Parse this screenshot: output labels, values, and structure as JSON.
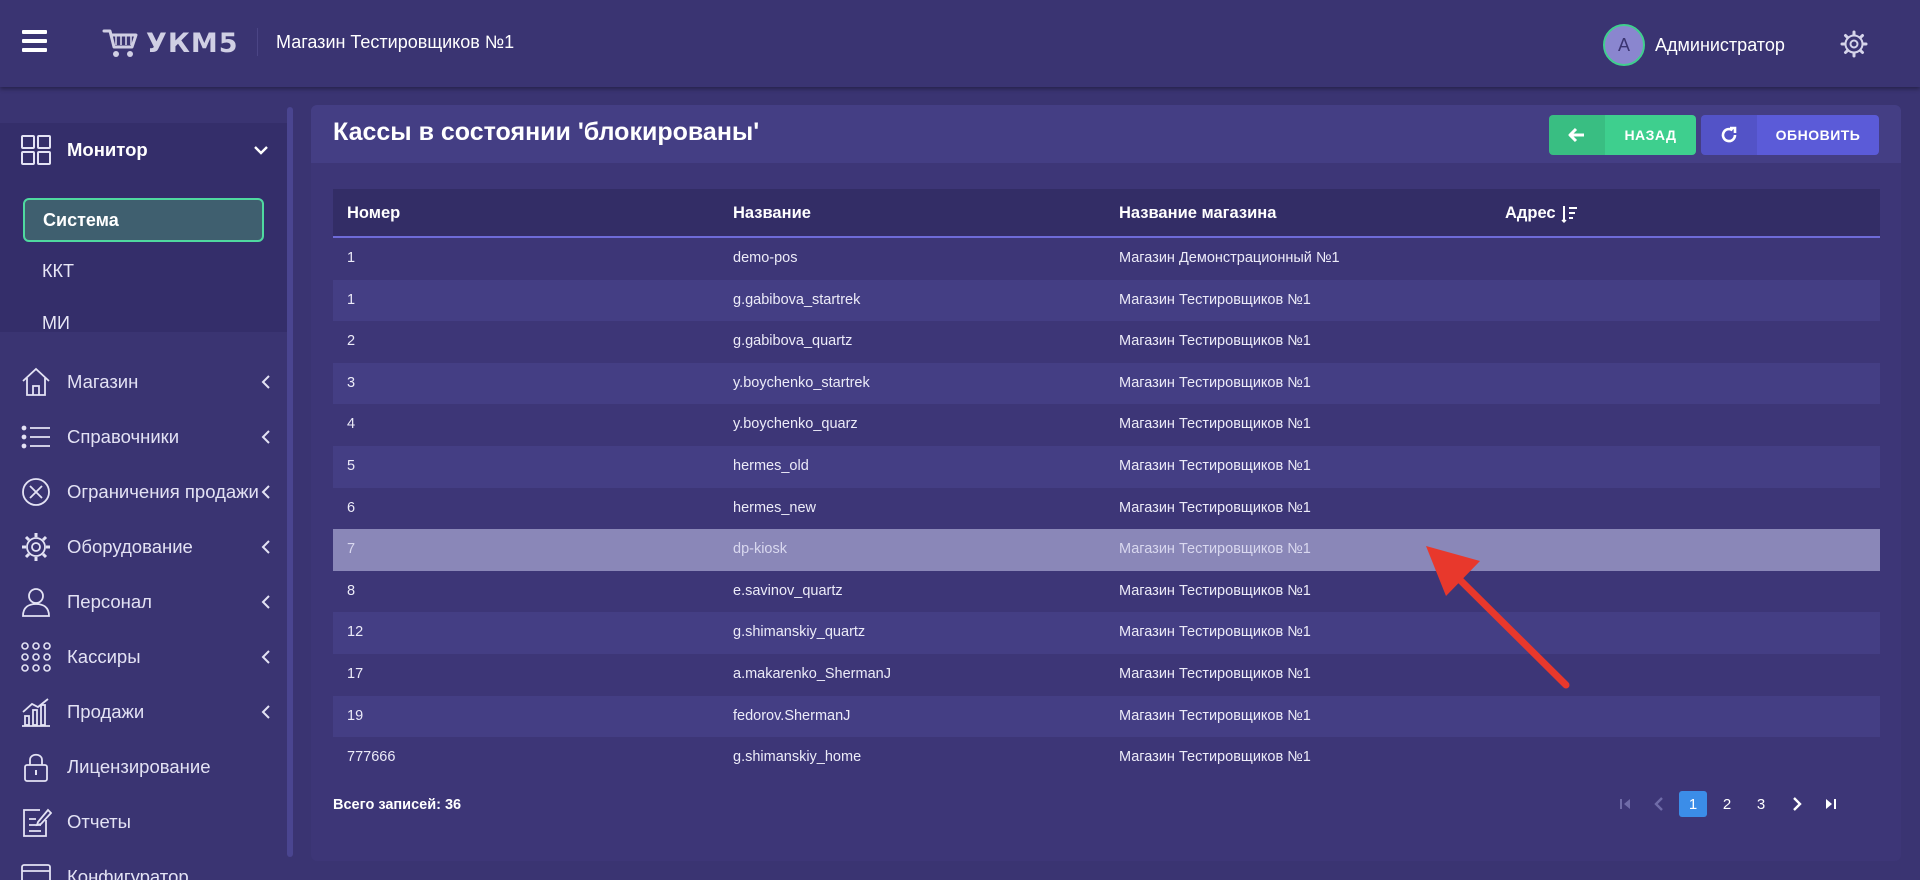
{
  "header": {
    "logo_text": "УКМ5",
    "store_name": "Магазин Тестировщиков №1",
    "avatar_letter": "А",
    "username": "Администратор"
  },
  "sidebar": {
    "monitor_label": "Монитор",
    "submenu": [
      {
        "label": "Система",
        "active": true
      },
      {
        "label": "ККТ",
        "active": false
      },
      {
        "label": "МИ",
        "active": false
      }
    ],
    "items": [
      {
        "label": "Магазин",
        "icon": "home-icon",
        "has_submenu": true
      },
      {
        "label": "Справочники",
        "icon": "list-icon",
        "has_submenu": true
      },
      {
        "label": "Ограничения продажи",
        "icon": "restriction-icon",
        "has_submenu": true
      },
      {
        "label": "Оборудование",
        "icon": "equipment-gear-icon",
        "has_submenu": true
      },
      {
        "label": "Персонал",
        "icon": "person-icon",
        "has_submenu": true
      },
      {
        "label": "Кассиры",
        "icon": "cashiers-grid-icon",
        "has_submenu": true
      },
      {
        "label": "Продажи",
        "icon": "sales-chart-icon",
        "has_submenu": true
      },
      {
        "label": "Лицензирование",
        "icon": "lock-icon",
        "has_submenu": false
      },
      {
        "label": "Отчеты",
        "icon": "report-icon",
        "has_submenu": false
      },
      {
        "label": "Конфигуратор",
        "icon": "configurator-icon",
        "has_submenu": false
      }
    ]
  },
  "panel": {
    "title": "Кассы в состоянии 'блокированы'",
    "back_label": "НАЗАД",
    "refresh_label": "ОБНОВИТЬ"
  },
  "table": {
    "columns": [
      "Номер",
      "Название",
      "Название магазина",
      "Адрес"
    ],
    "rows": [
      {
        "num": "1",
        "name": "demo-pos",
        "store": "Магазин Демонстрационный №1",
        "addr": ""
      },
      {
        "num": "1",
        "name": "g.gabibova_startrek",
        "store": "Магазин Тестировщиков №1",
        "addr": ""
      },
      {
        "num": "2",
        "name": "g.gabibova_quartz",
        "store": "Магазин Тестировщиков №1",
        "addr": ""
      },
      {
        "num": "3",
        "name": "y.boychenko_startrek",
        "store": "Магазин Тестировщиков №1",
        "addr": ""
      },
      {
        "num": "4",
        "name": "y.boychenko_quarz",
        "store": "Магазин Тестировщиков №1",
        "addr": ""
      },
      {
        "num": "5",
        "name": "hermes_old",
        "store": "Магазин Тестировщиков №1",
        "addr": ""
      },
      {
        "num": "6",
        "name": "hermes_new",
        "store": "Магазин Тестировщиков №1",
        "addr": ""
      },
      {
        "num": "7",
        "name": "dp-kiosk",
        "store": "Магазин Тестировщиков №1",
        "addr": "",
        "selected": true
      },
      {
        "num": "8",
        "name": "e.savinov_quartz",
        "store": "Магазин Тестировщиков №1",
        "addr": ""
      },
      {
        "num": "12",
        "name": "g.shimanskiy_quartz",
        "store": "Магазин Тестировщиков №1",
        "addr": ""
      },
      {
        "num": "17",
        "name": "a.makarenko_ShermanJ",
        "store": "Магазин Тестировщиков №1",
        "addr": ""
      },
      {
        "num": "19",
        "name": "fedorov.ShermanJ",
        "store": "Магазин Тестировщиков №1",
        "addr": ""
      },
      {
        "num": "777666",
        "name": "g.shimanskiy_home",
        "store": "Магазин Тестировщиков №1",
        "addr": ""
      }
    ]
  },
  "footer": {
    "total_label": "Всего записей: 36",
    "pages": [
      "1",
      "2",
      "3"
    ],
    "current_page": "1"
  },
  "colors": {
    "background": "#3a3472",
    "accent_green": "#3ecf8e",
    "accent_blue": "#5b5bd8",
    "page_active": "#3b8de8",
    "annotation_arrow": "#e8382c"
  }
}
